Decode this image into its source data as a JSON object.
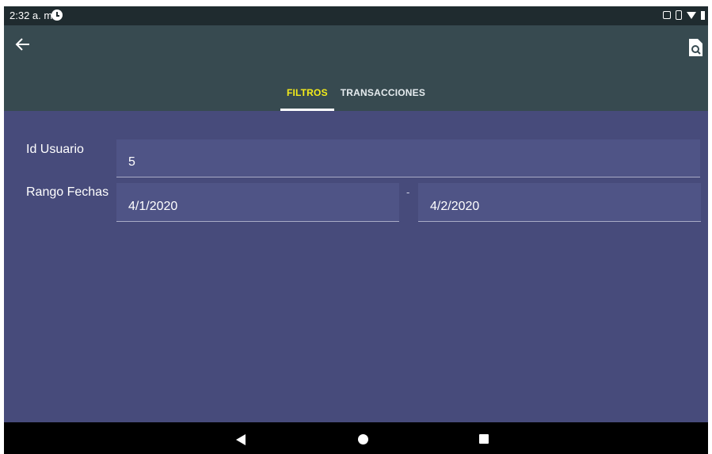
{
  "status_bar": {
    "time": "2:32 a. m.",
    "icons": [
      "clock-icon",
      "screenshot-icon",
      "vibrate-icon",
      "wifi-icon",
      "battery-icon"
    ]
  },
  "app_bar": {
    "back_icon": "arrow-back-icon",
    "action_icon": "document-search-icon",
    "background_color": "#374a50"
  },
  "tabs": [
    {
      "label": "FILTROS",
      "active": true
    },
    {
      "label": "TRANSACCIONES",
      "active": false
    }
  ],
  "form": {
    "id_usuario": {
      "label": "Id Usuario",
      "value": "5"
    },
    "rango_fechas": {
      "label": "Rango Fechas",
      "from": "4/1/2020",
      "separator": "-",
      "to": "4/2/2020"
    }
  },
  "colors": {
    "content_background": "#474b7b",
    "active_tab_text": "#f4ec1a"
  },
  "nav_bar": {
    "icons": [
      "nav-back-icon",
      "nav-home-icon",
      "nav-recents-icon"
    ]
  }
}
